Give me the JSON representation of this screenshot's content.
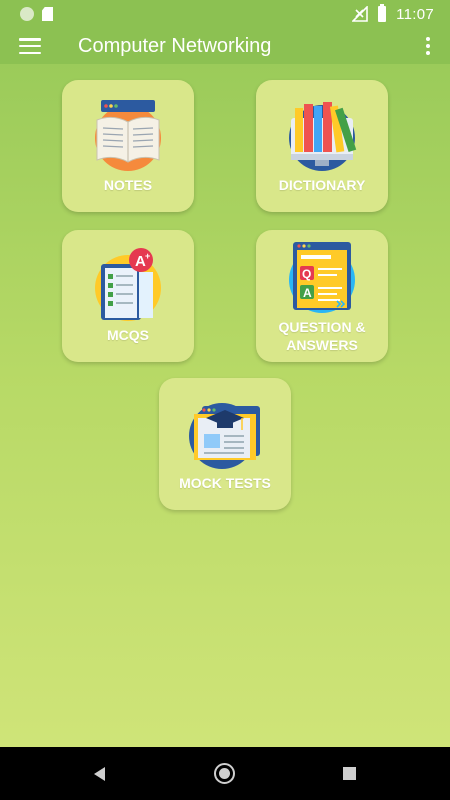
{
  "status_bar": {
    "time": "11:07",
    "icons": [
      "notification-dot-icon",
      "sd-card-icon",
      "no-signal-icon",
      "battery-icon"
    ]
  },
  "app_bar": {
    "title": "Computer Networking",
    "menu_icon": "hamburger-menu-icon",
    "overflow_icon": "more-vert-icon",
    "color": "#8cc152"
  },
  "tiles": [
    {
      "label": "NOTES",
      "icon": "open-book-icon"
    },
    {
      "label": "DICTIONARY",
      "icon": "bookshelf-monitor-icon"
    },
    {
      "label": "MCQS",
      "icon": "checklist-grade-icon"
    },
    {
      "label": "QUESTION & ANSWERS",
      "icon": "qa-document-icon"
    },
    {
      "label": "MOCK TESTS",
      "icon": "graduation-test-icon"
    }
  ],
  "nav_bar": {
    "back_icon": "back-triangle-icon",
    "home_icon": "home-circle-icon",
    "recents_icon": "recents-square-icon"
  },
  "colors": {
    "tile_bg": "#d9e78a",
    "background_top": "#9bcb5a",
    "background_bottom": "#cfe478"
  }
}
